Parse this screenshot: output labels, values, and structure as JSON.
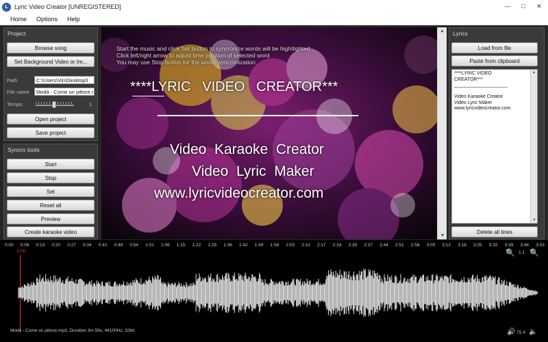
{
  "window": {
    "title": "Lyric Video Creator [UNREGISTERED]"
  },
  "menu": [
    "Home",
    "Options",
    "Help"
  ],
  "project": {
    "title": "Project",
    "browse_label": "Browse song",
    "set_bg_label": "Set Background Video or Im...",
    "path_label": "Path",
    "path_value": "C:\\Users\\Vin\\Desktop\\l",
    "filename_label": "File name",
    "filename_value": "Modà - Come un pittore.r",
    "tempo_label": "Tempo",
    "tempo_value": "1",
    "open_label": "Open project",
    "save_label": "Save project"
  },
  "syncro": {
    "title": "Syncro tools",
    "start_label": "Start",
    "stop_label": "Stop",
    "set_label": "Set",
    "reset_label": "Reset all",
    "preview_label": "Preview",
    "create_label": "Create karaoke video"
  },
  "video": {
    "instructions": [
      "Start the music and click Set button to syncronize words will be hightlighted",
      "Click left/right arrow to adjust time position of selected word",
      "You may use Stop button for the words syncronization"
    ],
    "heading": "****LYRIC   VIDEO   CREATOR***",
    "line1": "Video  Karaoke  Creator",
    "line2": "Video  Lyric  Maker",
    "line3": "www.lyricvideocreator.com"
  },
  "lyrics": {
    "title": "Lyrics",
    "load_label": "Load from file",
    "paste_label": "Paste from clipboard",
    "content": [
      "****LYRIC VIDEO",
      "CREATOR***",
      "____________________",
      "",
      "Video Karaoke Creator",
      "Video Lyric Maker",
      "www.lyricvideocreator.com"
    ],
    "delete_label": "Delete all lines"
  },
  "timeline": {
    "ticks": [
      "0:00",
      "0:06",
      "0:13",
      "0:20",
      "0:27",
      "0:34",
      "0:41",
      "0:48",
      "0:54",
      "1:01",
      "1:08",
      "1:15",
      "1:22",
      "1:29",
      "1:36",
      "1:42",
      "1:49",
      "1:56",
      "2:03",
      "2:10",
      "2:17",
      "2:24",
      "2:30",
      "2:37",
      "2:44",
      "2:51",
      "2:58",
      "3:05",
      "3:12",
      "3:18",
      "3:25",
      "3:32",
      "3:39",
      "3:46",
      "3:53"
    ],
    "cursor": "0:05",
    "zoom_ratio": "1:1",
    "volume": "75 X",
    "info": "Modà - Come un pittore.mp3,  Duration 3m 59s,  44100Hz, 32bit"
  }
}
